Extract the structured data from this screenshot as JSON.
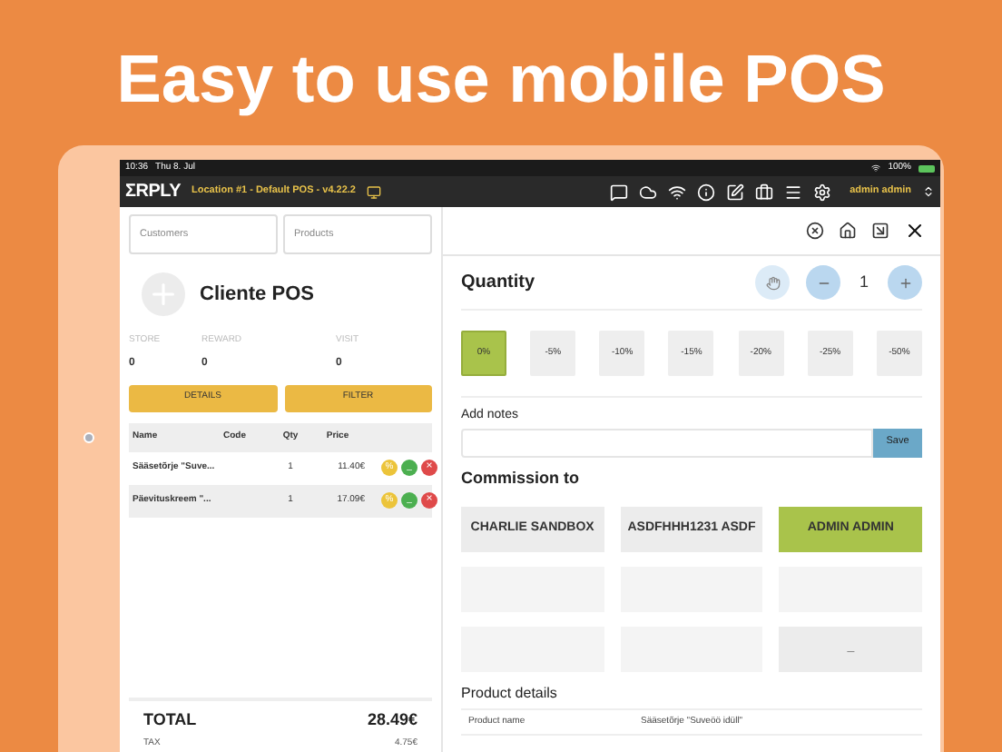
{
  "headline": "Easy to use mobile POS",
  "status_bar": {
    "time": "10:36",
    "date": "Thu 8. Jul",
    "battery": "100%"
  },
  "header": {
    "logo": "ΣRPLY",
    "location": "Location #1 - Default POS - v4.22.2",
    "user": "admin admin"
  },
  "left": {
    "customer_placeholder": "Customers",
    "product_placeholder": "Products",
    "customer_name": "Cliente POS",
    "stats": [
      {
        "label": "STORE",
        "value": "0"
      },
      {
        "label": "REWARD",
        "value": "0"
      },
      {
        "label": "VISIT",
        "value": "0"
      }
    ],
    "buttons": [
      "DETAILS",
      "FILTER"
    ],
    "table": {
      "columns": [
        "Name",
        "Code",
        "Qty",
        "Price"
      ],
      "rows": [
        {
          "name": "Sääsetõrje \"Suve...",
          "qty": "1",
          "price": "11.40€",
          "discount_icon": "%",
          "minus_icon": "_",
          "remove_icon": "×"
        },
        {
          "name": "Päevituskreem \"...",
          "qty": "1",
          "price": "17.09€",
          "discount_icon": "%",
          "minus_icon": "_",
          "remove_icon": "×"
        }
      ]
    },
    "total_label": "TOTAL",
    "total": "28.49€",
    "tax_label": "TAX",
    "tax": "4.75€"
  },
  "right": {
    "quantity_label": "Quantity",
    "quantity": "1",
    "discounts": [
      {
        "label": "0%",
        "selected": true
      },
      {
        "label": "-5%",
        "selected": false
      },
      {
        "label": "-10%",
        "selected": false
      },
      {
        "label": "-15%",
        "selected": false
      },
      {
        "label": "-20%",
        "selected": false
      },
      {
        "label": "-25%",
        "selected": false
      },
      {
        "label": "-50%",
        "selected": false
      }
    ],
    "notes_label": "Add notes",
    "save_button": "Save",
    "commission_label": "Commission to",
    "commission": [
      {
        "label": "CHARLIE SANDBOX",
        "selected": false
      },
      {
        "label": "ASDFHHH1231 ASDF",
        "selected": false
      },
      {
        "label": "ADMIN ADMIN",
        "selected": true
      },
      {
        "selected": false
      },
      {
        "selected": false
      },
      {
        "selected": false
      },
      {
        "selected": false
      },
      {
        "selected": false
      },
      {
        "label": "_",
        "selected": false
      }
    ],
    "details_label": "Product details",
    "details": [
      {
        "key": "Product name",
        "value": "Sääsetõrje \"Suveöö idüll\""
      }
    ]
  }
}
